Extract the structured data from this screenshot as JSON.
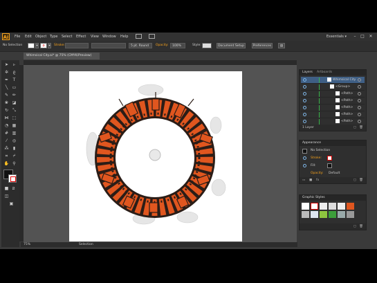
{
  "menubar": {
    "logo": "Ai",
    "items": [
      "File",
      "Edit",
      "Object",
      "Type",
      "Select",
      "Effect",
      "View",
      "Window",
      "Help"
    ],
    "workspace": "Essentials ▾"
  },
  "controlbar": {
    "selection_label": "No Selection",
    "stroke_label": "Stroke:",
    "brush_value": "5 pt. Round",
    "opacity_label": "Opacity:",
    "opacity_value": "100%",
    "style_label": "Style:",
    "document_setup": "Document Setup",
    "preferences": "Preferences"
  },
  "document": {
    "tab_title": "Whimsical City.ai* @ 75% (CMYK/Preview)"
  },
  "status": {
    "zoom": "75%",
    "tool": "Selection"
  },
  "layers_panel": {
    "tab_active": "Layers",
    "tab_inactive": "Artboards",
    "rows": [
      "Whimsical City",
      "<Group>",
      "<Path>",
      "<Path>",
      "<Path>",
      "<Path>",
      "<Path>",
      "<Path>"
    ],
    "footer": "1 Layer"
  },
  "appearance_panel": {
    "title": "Appearance",
    "selection": "No Selection",
    "stroke_label": "Stroke:",
    "fill_label": "Fill:",
    "opacity_label": "Opacity:",
    "opacity_value": "Default"
  },
  "graphic_styles_panel": {
    "title": "Graphic Styles"
  },
  "colors": {
    "accent": "#f7a21b",
    "artwork_orange": "#e0561f",
    "artwork_outline": "#2b1d17",
    "layer_color": "#39b54a"
  }
}
